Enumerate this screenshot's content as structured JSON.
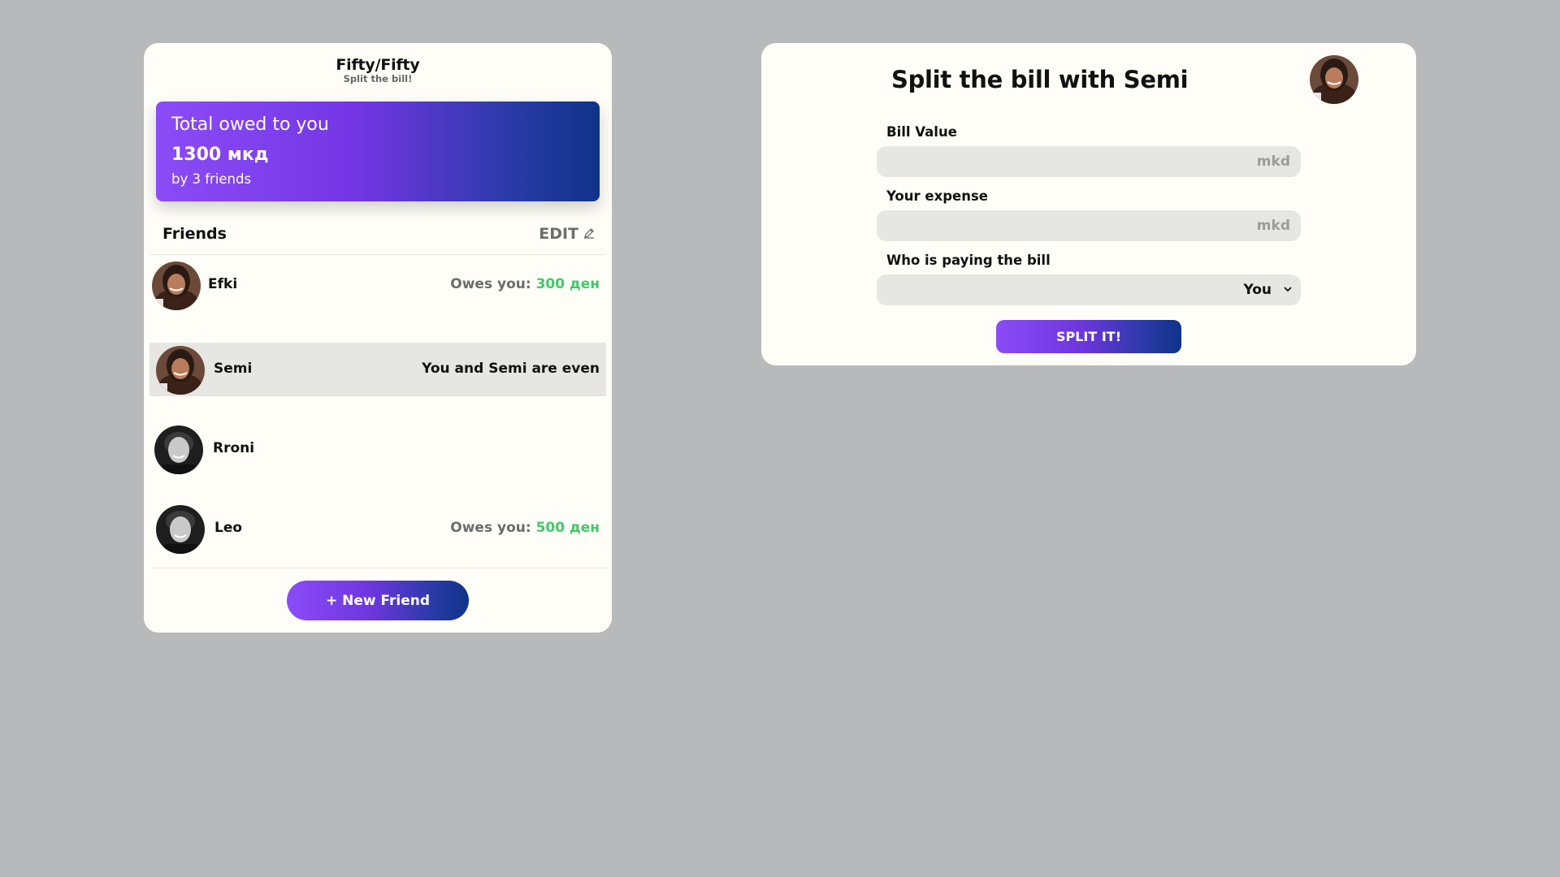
{
  "app": {
    "title": "Fifty/Fifty",
    "subtitle": "Split the bill!"
  },
  "summary": {
    "title": "Total owed to you",
    "amount": "1300 мкд",
    "subtitle": "by 3 friends"
  },
  "friends_section": {
    "title": "Friends",
    "edit_label": "EDIT",
    "items": [
      {
        "name": "Efki",
        "status_label": "Owes you:",
        "status_amount": "300 ден",
        "selected": false,
        "avatar": "woman-portrait"
      },
      {
        "name": "Semi",
        "status_label": "You and Semi are even",
        "status_amount": "",
        "selected": true,
        "avatar": "woman-portrait"
      },
      {
        "name": "Rroni",
        "status_label": "",
        "status_amount": "",
        "selected": false,
        "avatar": "man-portrait-bw"
      },
      {
        "name": "Leo",
        "status_label": "Owes you:",
        "status_amount": "500 ден",
        "selected": false,
        "avatar": "man-portrait-bw"
      }
    ],
    "new_friend_label": "+ New Friend"
  },
  "split_form": {
    "title": "Split the bill with Semi",
    "bill_value_label": "Bill Value",
    "bill_value": "",
    "bill_value_unit": "mkd",
    "your_expense_label": "Your expense",
    "your_expense": "",
    "your_expense_unit": "mkd",
    "payer_label": "Who is paying the bill",
    "payer_selected": "You",
    "submit_label": "SPLIT IT!"
  },
  "colors": {
    "background": "#b8b9bb",
    "card": "#fefdf8",
    "accent_start": "#8b4cf7",
    "accent_end": "#0f3388",
    "owes_green": "#42c86a",
    "selected_row": "#e6e6e2"
  }
}
